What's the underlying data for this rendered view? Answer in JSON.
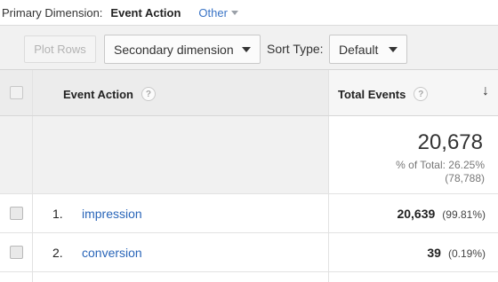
{
  "primary_dimension": {
    "label": "Primary Dimension:",
    "current": "Event Action",
    "other": "Other"
  },
  "toolbar": {
    "plot_rows": "Plot Rows",
    "secondary_dimension": "Secondary dimension",
    "sort_type_label": "Sort Type:",
    "sort_type_value": "Default"
  },
  "table": {
    "headers": {
      "event_action": "Event Action",
      "total_events": "Total Events",
      "help_glyph": "?",
      "sort_glyph": "↓"
    },
    "totals": {
      "value": "20,678",
      "pct_of_total": "% of Total: 26.25%",
      "absolute_total": "(78,788)"
    },
    "rows": [
      {
        "index": "1.",
        "event_action": "impression",
        "total_events": "20,639",
        "pct": "(99.81%)"
      },
      {
        "index": "2.",
        "event_action": "conversion",
        "total_events": "39",
        "pct": "(0.19%)"
      }
    ]
  },
  "colors": {
    "link": "#2a66b9",
    "other_link": "#3a74c6"
  }
}
